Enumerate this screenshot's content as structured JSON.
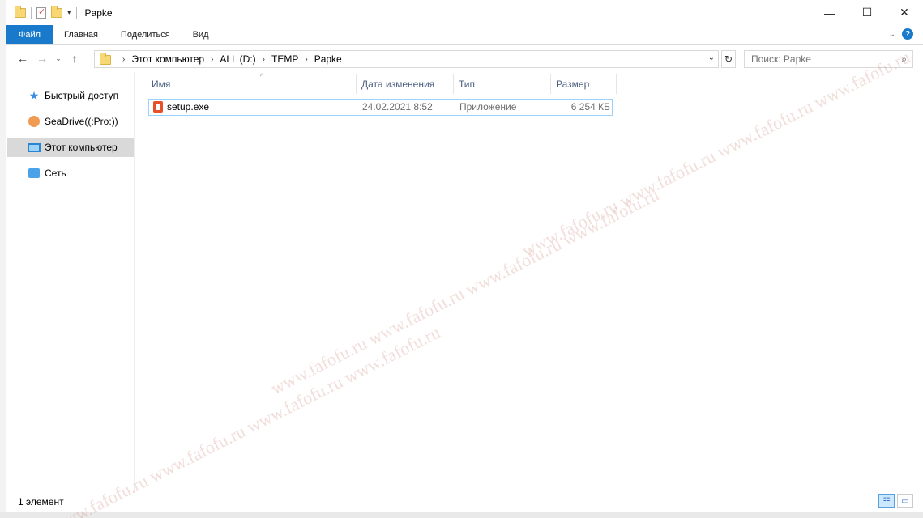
{
  "title_bar": {
    "title": "Papke",
    "qat_dropdown_icon": "caret-down-icon",
    "buttons": {
      "minimize": "—",
      "maximize": "☐",
      "close": "✕"
    }
  },
  "ribbon": {
    "tabs": [
      {
        "label": "Файл"
      },
      {
        "label": "Главная"
      },
      {
        "label": "Поделиться"
      },
      {
        "label": "Вид"
      }
    ],
    "help_label": "?"
  },
  "nav": {
    "back": "←",
    "forward": "→",
    "recent": "⌄",
    "up": "↑"
  },
  "address": {
    "crumbs": [
      "Этот компьютер",
      "ALL (D:)",
      "TEMP",
      "Papke"
    ]
  },
  "search": {
    "placeholder": "Поиск: Papke"
  },
  "sidebar": {
    "items": [
      {
        "label": "Быстрый доступ",
        "icon": "star-icon"
      },
      {
        "label": "SeaDrive((:Pro:))",
        "icon": "seadrive-icon"
      },
      {
        "label": "Этот компьютер",
        "icon": "computer-icon",
        "selected": true
      },
      {
        "label": "Сеть",
        "icon": "network-icon"
      }
    ]
  },
  "columns": {
    "name": "Имя",
    "date": "Дата изменения",
    "type": "Тип",
    "size": "Размер"
  },
  "files": [
    {
      "name": "setup.exe",
      "date": "24.02.2021 8:52",
      "type": "Приложение",
      "size": "6 254 КБ",
      "icon": "office-setup-icon"
    }
  ],
  "status": {
    "count_text": "1 элемент"
  },
  "watermark": {
    "text": "www.fafofu.ru www.fafofu.ru www.fafofu.ru www.fafofu.ru"
  }
}
